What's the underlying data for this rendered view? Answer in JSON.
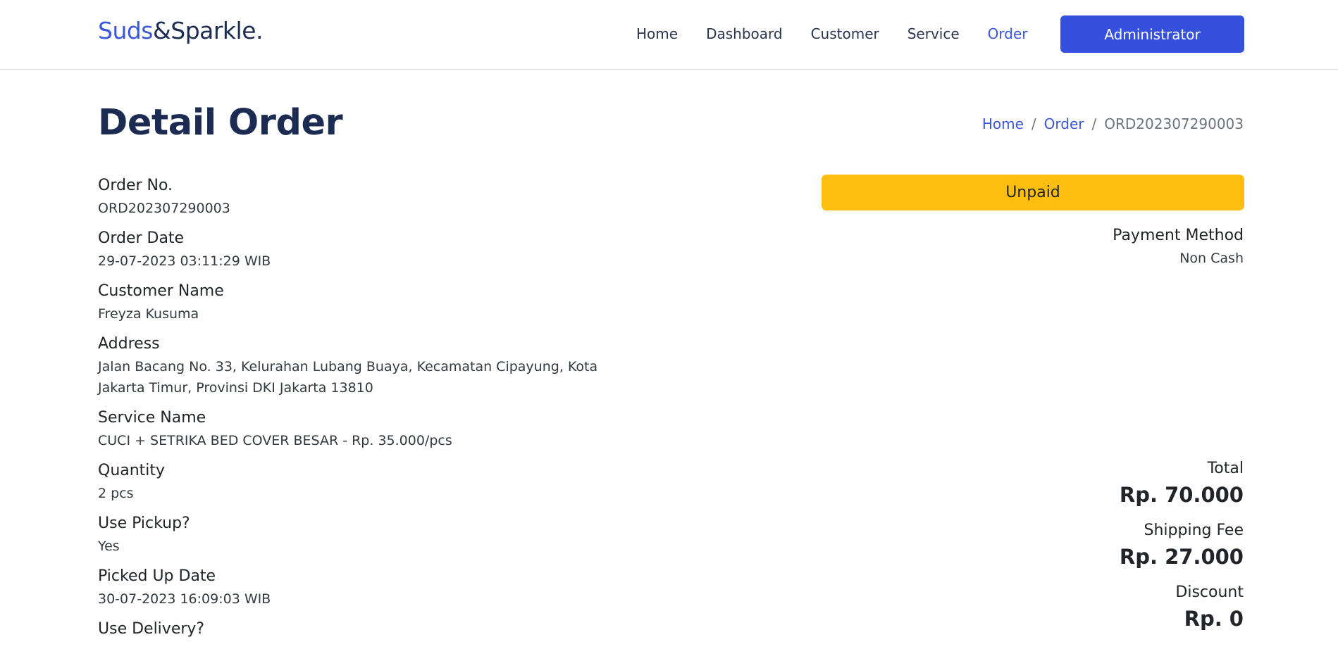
{
  "brand": {
    "part1": "Suds",
    "part2": "&Sparkle."
  },
  "nav": {
    "items": [
      {
        "label": "Home"
      },
      {
        "label": "Dashboard"
      },
      {
        "label": "Customer"
      },
      {
        "label": "Service"
      },
      {
        "label": "Order",
        "active": true
      }
    ],
    "user_button": "Administrator"
  },
  "header": {
    "title": "Detail Order",
    "breadcrumb": {
      "home": "Home",
      "order": "Order",
      "current": "ORD202307290003",
      "separator": "/"
    }
  },
  "details": {
    "order_no": {
      "label": "Order No.",
      "value": "ORD202307290003"
    },
    "order_date": {
      "label": "Order Date",
      "value": "29-07-2023 03:11:29 WIB"
    },
    "customer_name": {
      "label": "Customer Name",
      "value": "Freyza Kusuma"
    },
    "address": {
      "label": "Address",
      "value": "Jalan Bacang No. 33, Kelurahan Lubang Buaya, Kecamatan Cipayung, Kota Jakarta Timur, Provinsi DKI Jakarta 13810"
    },
    "service_name": {
      "label": "Service Name",
      "value": "CUCI + SETRIKA BED COVER BESAR - Rp. 35.000/pcs"
    },
    "quantity": {
      "label": "Quantity",
      "value": "2 pcs"
    },
    "use_pickup": {
      "label": "Use Pickup?",
      "value": "Yes"
    },
    "picked_up_date": {
      "label": "Picked Up Date",
      "value": "30-07-2023 16:09:03 WIB"
    },
    "use_delivery": {
      "label": "Use Delivery?"
    }
  },
  "status": {
    "label": "Unpaid",
    "color": "#fdbe10"
  },
  "payment": {
    "label": "Payment Method",
    "value": "Non Cash"
  },
  "totals": {
    "total": {
      "label": "Total",
      "amount": "Rp. 70.000"
    },
    "shipping": {
      "label": "Shipping Fee",
      "amount": "Rp. 27.000"
    },
    "discount": {
      "label": "Discount",
      "amount": "Rp. 0"
    }
  },
  "colors": {
    "accent": "#3a57d9",
    "primary_button": "#3550dd",
    "title": "#1c2b52",
    "status_unpaid": "#fdbe10"
  }
}
